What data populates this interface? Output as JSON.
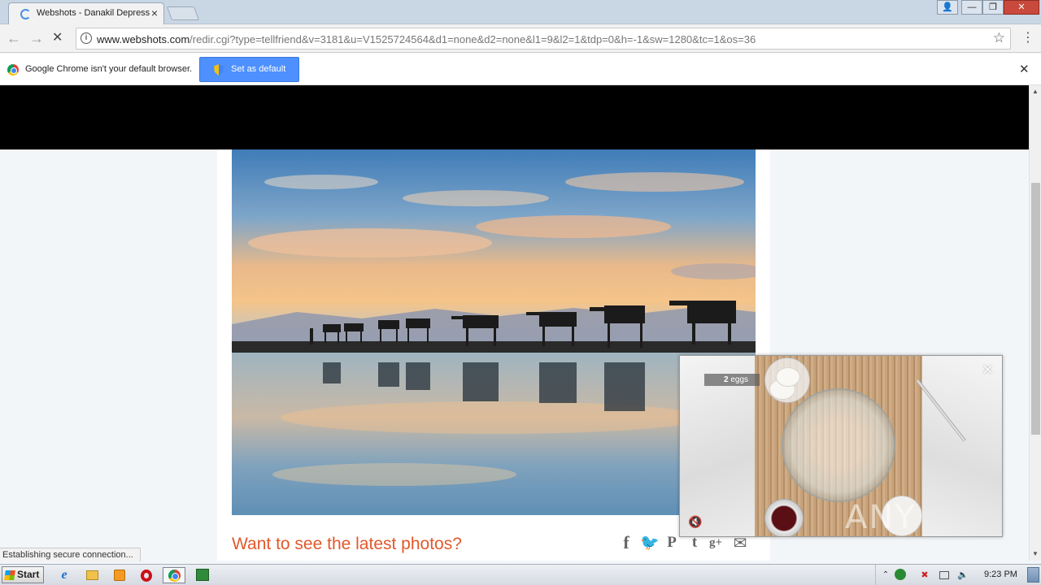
{
  "browser": {
    "tab": {
      "title": "Webshots - Danakil Depress",
      "close": "×"
    },
    "window_controls": {
      "user": "👤",
      "minimize": "—",
      "maximize": "❐",
      "close": "✕"
    },
    "nav": {
      "back": "←",
      "forward": "→",
      "stop": "✕"
    },
    "omnibox": {
      "info": "i",
      "url_host": "www.webshots.com",
      "url_rest": "/redir.cgi?type=tellfriend&v=3181&u=V1525724564&d1=none&d2=none&l1=9&l2=1&tdp=0&h=-1&sw=1280&tc=1&os=36",
      "star": "☆"
    },
    "menu": "⋮",
    "infobar": {
      "message": "Google Chrome isn't your default browser.",
      "button_label": "Set as default",
      "close": "✕"
    },
    "status_text": "Establishing secure connection..."
  },
  "page": {
    "cta": "Want to see the latest photos?",
    "share_icons": {
      "facebook": "f",
      "twitter": "🐦",
      "pinterest": "P",
      "tumblr": "t",
      "gplus": "g+",
      "email": "✉"
    }
  },
  "video": {
    "label_count": "2",
    "label_unit": "eggs",
    "close": "×",
    "mute": "🔇",
    "watermark": "ANY RUN"
  },
  "scrollbar": {
    "up": "▲",
    "down": "▼"
  },
  "taskbar": {
    "start": "Start",
    "ie": "e",
    "tray_chevron": "⌃",
    "tray_flag": "✖",
    "tray_volume": "🔈",
    "clock": "9:23 PM"
  }
}
